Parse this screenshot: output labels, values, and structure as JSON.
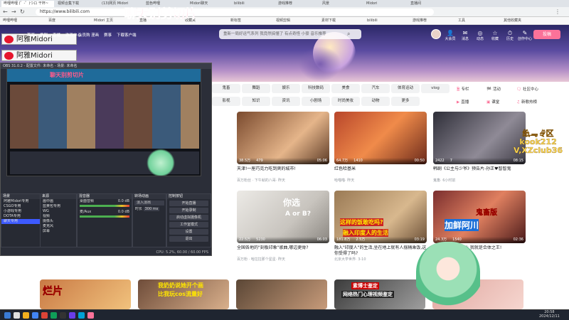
{
  "overlay": {
    "clip_sign": "聊天别剪切片",
    "streamer_name": "阿雅Midori",
    "streamer_name2": "阿雅Midori",
    "kook_line1": "纸鸢专区",
    "kook_line2": "kook212",
    "kook_line3": "V,XZclub36"
  },
  "browser": {
    "tabs": [
      "哔哩哔哩 (゜-゜)つロ 干杯~",
      "视频合集下载",
      "(13)网页 Midori",
      "蓝色哔哩",
      "Midori聊天",
      "bilibili",
      "游戏推荐",
      "风景",
      "Midori",
      "直播间"
    ],
    "url": "https://www.bilibili.com",
    "bookmarks": [
      "哔哩哔哩",
      "百度",
      "Midori 主页",
      "直播",
      "收藏夹",
      "新标签",
      "视频剪辑",
      "素材下载",
      "bilibili",
      "游戏推荐",
      "工具",
      "其他收藏夹"
    ]
  },
  "bili": {
    "nav": [
      "首页",
      "番剧",
      "直播",
      "游戏中心",
      "会员购",
      "漫画",
      "赛事",
      "下载客户端"
    ],
    "search_placeholder": "重新一局好运气系列 我竟然搞懂了 有点奇怪 小豪 音乐推荐",
    "right": [
      {
        "icon": "👤",
        "label": "大会员"
      },
      {
        "icon": "✉",
        "label": "消息"
      },
      {
        "icon": "◎",
        "label": "动态"
      },
      {
        "icon": "☆",
        "label": "收藏"
      },
      {
        "icon": "⏱",
        "label": "历史"
      },
      {
        "icon": "✎",
        "label": "创作中心"
      }
    ],
    "upload": "投稿",
    "cats": [
      "鬼畜",
      "舞蹈",
      "娱乐",
      "科技数码",
      "美食",
      "汽车",
      "体育运动",
      "vlog",
      "影视",
      "知识",
      "资讯",
      "小剧场",
      "时尚美妆",
      "动物",
      "更多"
    ],
    "side": [
      "专栏",
      "活动",
      "社区中心",
      "直播",
      "课堂",
      "新歌热榜"
    ],
    "cards": [
      {
        "title": "天津!一座巧克力吃到爽的城市!",
        "views": "38.5万",
        "comments": "479",
        "duration": "05:06",
        "author": "百万粉丝 · 下午就的八哥",
        "date": "· 昨天"
      },
      {
        "title": "红色哈基米",
        "views": "64.7万",
        "comments": "1410",
        "duration": "00:50",
        "author": "哈喵喵",
        "date": "· 昨天"
      },
      {
        "title": "韩剧《公主与少爷》预告片-孙正♥智智鬼",
        "views": "2422",
        "comments": "7",
        "duration": "08:15",
        "author": "鬼畜",
        "date": "· 6小时前"
      },
      {
        "title": "全国各地的\"刻板印象\"歌曲,哪边更骨?",
        "views": "22.5万",
        "comments": "5230",
        "duration": "06:03",
        "author": "百万粉 · 哈拉拉那个星星",
        "date": "· 昨天"
      },
      {
        "title": "融入\"印度人\"的生活,坐在地上就有人摆桶乘饭,这你受得了吗?",
        "views": "181.8万",
        "comments": "2.5万",
        "duration": "03:19",
        "author": "北京大学世界",
        "date": "· 3-10"
      },
      {
        "title": "【鬼畜版】陈彦川: 我就是合体之王!",
        "views": "24.3万",
        "comments": "1540",
        "duration": "02:36",
        "author": "鬼畜区",
        "date": "· 昨天"
      }
    ],
    "overlays": {
      "c2": "你选",
      "c2a": "A or B?",
      "c5a": "这样的饭敢吃吗?",
      "c5b": "融入印度人的生活",
      "c6a": "鬼畜版",
      "c6b": "加鲜阿川",
      "b1": "烂片",
      "b2a": "我奶奶说她开个画",
      "b2b": "比我玩cos流量好",
      "b4a": "素博士鉴定",
      "b4b": "网络热门心理视频鉴定"
    }
  },
  "obs": {
    "title": "OBS 31.0.2 - 配置文件: 未命名 - 场景: 未命名",
    "preview_label": "聊天别剪切片",
    "scenes_header": "场景",
    "sources_header": "来源",
    "mixer_header": "混音器",
    "transitions_header": "转场动画",
    "controls_header": "控制按钮",
    "scenes": [
      "阿雅Midori专用",
      "CSGO专用",
      "小游戏专用",
      "DOTA专用",
      "聊天专用"
    ],
    "sources": [
      "画中画",
      "蓝黄包专用",
      "WG",
      "视频",
      "摄像头",
      "麦克风",
      "屏幕"
    ],
    "mixer": [
      {
        "name": "桌面音频",
        "level": "0.0 dB"
      },
      {
        "name": "麦/Aux",
        "level": "0.0 dB"
      }
    ],
    "transition": "淡入淡出",
    "duration_label": "时长",
    "duration": "300 ms",
    "controls": [
      "开始直播",
      "开始录制",
      "启动虚拟摄像机",
      "工作室模式",
      "设置",
      "退出"
    ],
    "status": "CPU: 5.2%, 60.00 / 60.00 FPS"
  },
  "taskbar": {
    "time": "20:58",
    "date": "2024/12/11"
  }
}
